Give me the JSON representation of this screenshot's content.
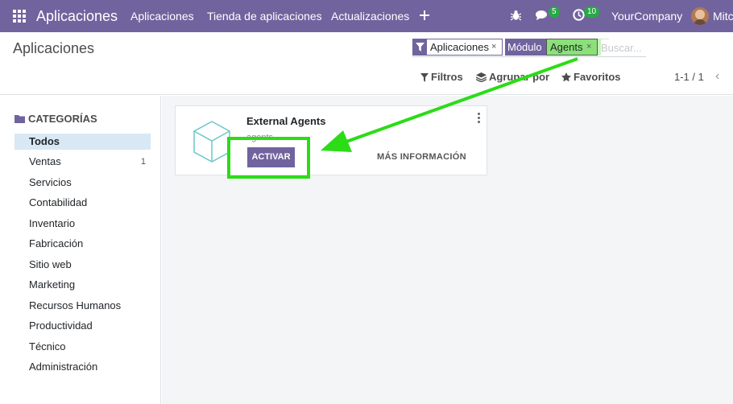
{
  "navbar": {
    "brand": "Aplicaciones",
    "menu": [
      "Aplicaciones",
      "Tienda de aplicaciones",
      "Actualizaciones"
    ],
    "add_icon": "plus-icon",
    "bug_icon": "bug-icon",
    "messages_count": "5",
    "activities_count": "10",
    "company": "YourCompany",
    "user": "Mitc"
  },
  "control_panel": {
    "title": "Aplicaciones",
    "facet_filter_label": "Aplicaciones",
    "facet_module_label": "Módulo",
    "facet_module_value": "Agents",
    "facet_remove": "×",
    "search_placeholder": "Buscar...",
    "filters_label": "Filtros",
    "group_by_label": "Agrupar por",
    "favorites_label": "Favoritos",
    "pager": "1-1 / 1",
    "pager_prev": "‹"
  },
  "sidebar": {
    "header": "CATEGORÍAS",
    "items": [
      {
        "label": "Todos",
        "count": ""
      },
      {
        "label": "Ventas",
        "count": "1"
      },
      {
        "label": "Servicios",
        "count": ""
      },
      {
        "label": "Contabilidad",
        "count": ""
      },
      {
        "label": "Inventario",
        "count": ""
      },
      {
        "label": "Fabricación",
        "count": ""
      },
      {
        "label": "Sitio web",
        "count": ""
      },
      {
        "label": "Marketing",
        "count": ""
      },
      {
        "label": "Recursos Humanos",
        "count": ""
      },
      {
        "label": "Productividad",
        "count": ""
      },
      {
        "label": "Técnico",
        "count": ""
      },
      {
        "label": "Administración",
        "count": ""
      }
    ]
  },
  "module_card": {
    "name": "External Agents",
    "technical_name": "agents",
    "activate_label": "ACTIVAR",
    "more_info_label": "MÁS INFORMACIÓN"
  },
  "colors": {
    "brand": "#71639e",
    "badge": "#28a745",
    "annotation": "#2bdc17"
  }
}
